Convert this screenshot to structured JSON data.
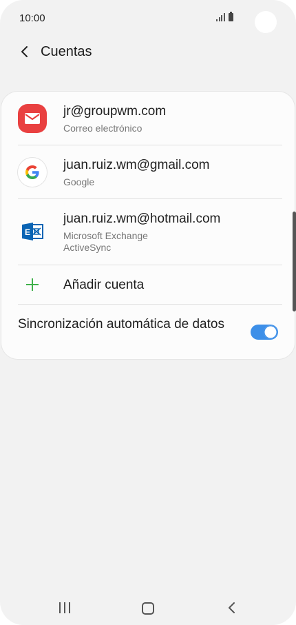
{
  "status_bar": {
    "time": "10:00",
    "icons": [
      "signal-icon",
      "battery-icon"
    ]
  },
  "header": {
    "title": "Cuentas",
    "back_icon": "chevron-left-icon"
  },
  "accounts": [
    {
      "icon": "email-app-icon",
      "name": "jr@groupwm.com",
      "type_line1": "Correo electrónico",
      "type_line2": ""
    },
    {
      "icon": "google-icon",
      "name": "juan.ruiz.wm@gmail.com",
      "type_line1": "Google",
      "type_line2": ""
    },
    {
      "icon": "exchange-icon",
      "name": "juan.ruiz.wm@hotmail.com",
      "type_line1": "Microsoft Exchange",
      "type_line2": "ActiveSync"
    }
  ],
  "add_account": {
    "label": "Añadir cuenta",
    "icon": "plus-icon"
  },
  "auto_sync": {
    "label": "Sincronización automática de datos",
    "enabled": true
  },
  "nav_bar": {
    "icons": [
      "recents-icon",
      "home-icon",
      "back-icon"
    ]
  },
  "colors": {
    "accent": "#3d8fe8",
    "email_icon_bg": "#e94040",
    "add_green": "#3fb04a",
    "exchange_blue": "#0a64b4",
    "background": "#f2f2f2"
  }
}
